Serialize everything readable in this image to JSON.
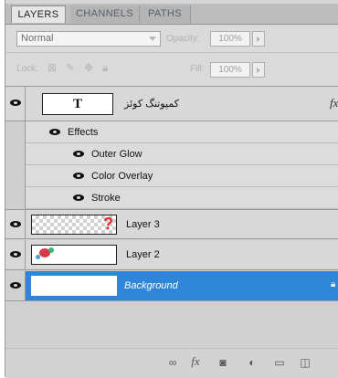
{
  "tabs": [
    {
      "label": "LAYERS",
      "active": true
    },
    {
      "label": "CHANNELS",
      "active": false
    },
    {
      "label": "PATHS",
      "active": false
    }
  ],
  "controls": {
    "blend_mode": "Normal",
    "opacity_label": "Opacity:",
    "opacity_value": "100%",
    "lock_label": "Lock:",
    "fill_label": "Fill:",
    "fill_value": "100%"
  },
  "layers": [
    {
      "name": "کمپوتنگ کوئز",
      "type": "text",
      "thumb_glyph": "T",
      "fx_badge": "fx",
      "effects_label": "Effects",
      "effects": [
        "Outer Glow",
        "Color Overlay",
        "Stroke"
      ]
    },
    {
      "name": "Layer 3",
      "type": "image"
    },
    {
      "name": "Layer 2",
      "type": "image"
    },
    {
      "name": "Background",
      "type": "background",
      "selected": true
    }
  ],
  "bottom_icons": [
    "link-icon",
    "fx-icon",
    "mask-icon",
    "adjustment-icon",
    "group-icon",
    "new-layer-icon"
  ],
  "bottom_labels": {
    "fx": "fx"
  },
  "colors": {
    "selected_row": "#2f86d8",
    "panel_bg": "#d6d6d6"
  }
}
